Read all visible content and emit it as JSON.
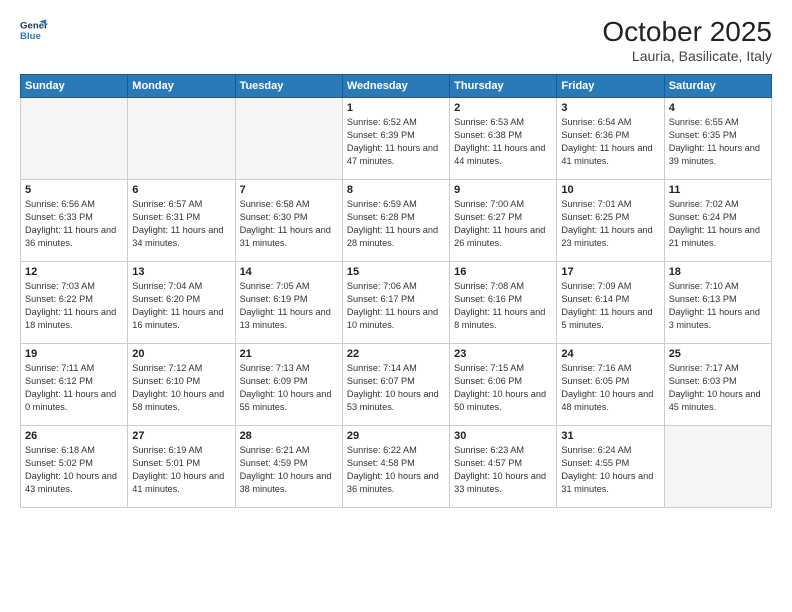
{
  "header": {
    "logo": {
      "line1": "General",
      "line2": "Blue"
    },
    "title": "October 2025",
    "subtitle": "Lauria, Basilicate, Italy"
  },
  "weekdays": [
    "Sunday",
    "Monday",
    "Tuesday",
    "Wednesday",
    "Thursday",
    "Friday",
    "Saturday"
  ],
  "weeks": [
    [
      {
        "day": null
      },
      {
        "day": null
      },
      {
        "day": null
      },
      {
        "day": "1",
        "sunrise": "6:52 AM",
        "sunset": "6:39 PM",
        "daylight": "11 hours and 47 minutes."
      },
      {
        "day": "2",
        "sunrise": "6:53 AM",
        "sunset": "6:38 PM",
        "daylight": "11 hours and 44 minutes."
      },
      {
        "day": "3",
        "sunrise": "6:54 AM",
        "sunset": "6:36 PM",
        "daylight": "11 hours and 41 minutes."
      },
      {
        "day": "4",
        "sunrise": "6:55 AM",
        "sunset": "6:35 PM",
        "daylight": "11 hours and 39 minutes."
      }
    ],
    [
      {
        "day": "5",
        "sunrise": "6:56 AM",
        "sunset": "6:33 PM",
        "daylight": "11 hours and 36 minutes."
      },
      {
        "day": "6",
        "sunrise": "6:57 AM",
        "sunset": "6:31 PM",
        "daylight": "11 hours and 34 minutes."
      },
      {
        "day": "7",
        "sunrise": "6:58 AM",
        "sunset": "6:30 PM",
        "daylight": "11 hours and 31 minutes."
      },
      {
        "day": "8",
        "sunrise": "6:59 AM",
        "sunset": "6:28 PM",
        "daylight": "11 hours and 28 minutes."
      },
      {
        "day": "9",
        "sunrise": "7:00 AM",
        "sunset": "6:27 PM",
        "daylight": "11 hours and 26 minutes."
      },
      {
        "day": "10",
        "sunrise": "7:01 AM",
        "sunset": "6:25 PM",
        "daylight": "11 hours and 23 minutes."
      },
      {
        "day": "11",
        "sunrise": "7:02 AM",
        "sunset": "6:24 PM",
        "daylight": "11 hours and 21 minutes."
      }
    ],
    [
      {
        "day": "12",
        "sunrise": "7:03 AM",
        "sunset": "6:22 PM",
        "daylight": "11 hours and 18 minutes."
      },
      {
        "day": "13",
        "sunrise": "7:04 AM",
        "sunset": "6:20 PM",
        "daylight": "11 hours and 16 minutes."
      },
      {
        "day": "14",
        "sunrise": "7:05 AM",
        "sunset": "6:19 PM",
        "daylight": "11 hours and 13 minutes."
      },
      {
        "day": "15",
        "sunrise": "7:06 AM",
        "sunset": "6:17 PM",
        "daylight": "11 hours and 10 minutes."
      },
      {
        "day": "16",
        "sunrise": "7:08 AM",
        "sunset": "6:16 PM",
        "daylight": "11 hours and 8 minutes."
      },
      {
        "day": "17",
        "sunrise": "7:09 AM",
        "sunset": "6:14 PM",
        "daylight": "11 hours and 5 minutes."
      },
      {
        "day": "18",
        "sunrise": "7:10 AM",
        "sunset": "6:13 PM",
        "daylight": "11 hours and 3 minutes."
      }
    ],
    [
      {
        "day": "19",
        "sunrise": "7:11 AM",
        "sunset": "6:12 PM",
        "daylight": "11 hours and 0 minutes."
      },
      {
        "day": "20",
        "sunrise": "7:12 AM",
        "sunset": "6:10 PM",
        "daylight": "10 hours and 58 minutes."
      },
      {
        "day": "21",
        "sunrise": "7:13 AM",
        "sunset": "6:09 PM",
        "daylight": "10 hours and 55 minutes."
      },
      {
        "day": "22",
        "sunrise": "7:14 AM",
        "sunset": "6:07 PM",
        "daylight": "10 hours and 53 minutes."
      },
      {
        "day": "23",
        "sunrise": "7:15 AM",
        "sunset": "6:06 PM",
        "daylight": "10 hours and 50 minutes."
      },
      {
        "day": "24",
        "sunrise": "7:16 AM",
        "sunset": "6:05 PM",
        "daylight": "10 hours and 48 minutes."
      },
      {
        "day": "25",
        "sunrise": "7:17 AM",
        "sunset": "6:03 PM",
        "daylight": "10 hours and 45 minutes."
      }
    ],
    [
      {
        "day": "26",
        "sunrise": "6:18 AM",
        "sunset": "5:02 PM",
        "daylight": "10 hours and 43 minutes."
      },
      {
        "day": "27",
        "sunrise": "6:19 AM",
        "sunset": "5:01 PM",
        "daylight": "10 hours and 41 minutes."
      },
      {
        "day": "28",
        "sunrise": "6:21 AM",
        "sunset": "4:59 PM",
        "daylight": "10 hours and 38 minutes."
      },
      {
        "day": "29",
        "sunrise": "6:22 AM",
        "sunset": "4:58 PM",
        "daylight": "10 hours and 36 minutes."
      },
      {
        "day": "30",
        "sunrise": "6:23 AM",
        "sunset": "4:57 PM",
        "daylight": "10 hours and 33 minutes."
      },
      {
        "day": "31",
        "sunrise": "6:24 AM",
        "sunset": "4:55 PM",
        "daylight": "10 hours and 31 minutes."
      },
      {
        "day": null
      }
    ]
  ]
}
